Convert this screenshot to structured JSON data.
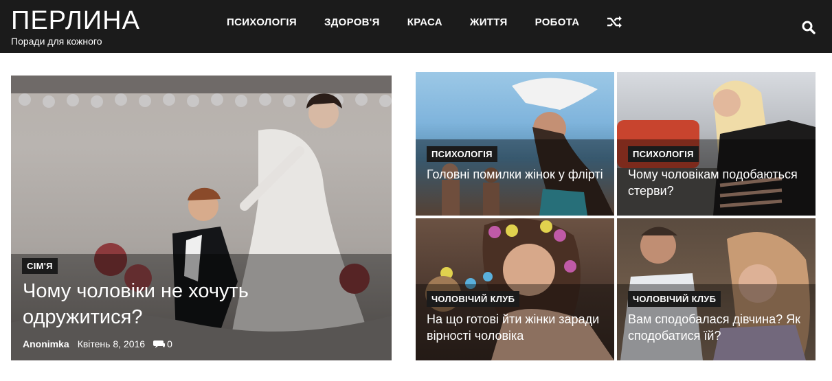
{
  "site": {
    "title": "ПЕРЛИНА",
    "tagline": "Поради для кожного"
  },
  "nav": {
    "items": [
      "ПСИХОЛОГІЯ",
      "ЗДОРОВ'Я",
      "КРАСА",
      "ЖИТТЯ",
      "РОБОТА"
    ]
  },
  "icons": {
    "shuffle": "shuffle-icon",
    "search": "search-icon",
    "comments": "comments-icon"
  },
  "colors": {
    "header_bg": "#1b1b1b",
    "badge_bg": "#1b1b1b",
    "text": "#ffffff"
  },
  "featured": {
    "category": "СІМ'Я",
    "title": "Чому чоловіки не хочуть одружитися?",
    "author": "Anonimka",
    "date": "Квітень 8, 2016",
    "comments": "0"
  },
  "grid": [
    {
      "category": "ПСИХОЛОГІЯ",
      "title": "Головні помилки жінок у флірті"
    },
    {
      "category": "ПСИХОЛОГІЯ",
      "title": "Чому чоловікам подобаються стерви?"
    },
    {
      "category": "ЧОЛОВІЧИЙ КЛУБ",
      "title": "На що готові йти жінки заради вірності чоловіка"
    },
    {
      "category": "ЧОЛОВІЧИЙ КЛУБ",
      "title": "Вам сподобалася дівчина? Як сподобатися їй?"
    }
  ]
}
